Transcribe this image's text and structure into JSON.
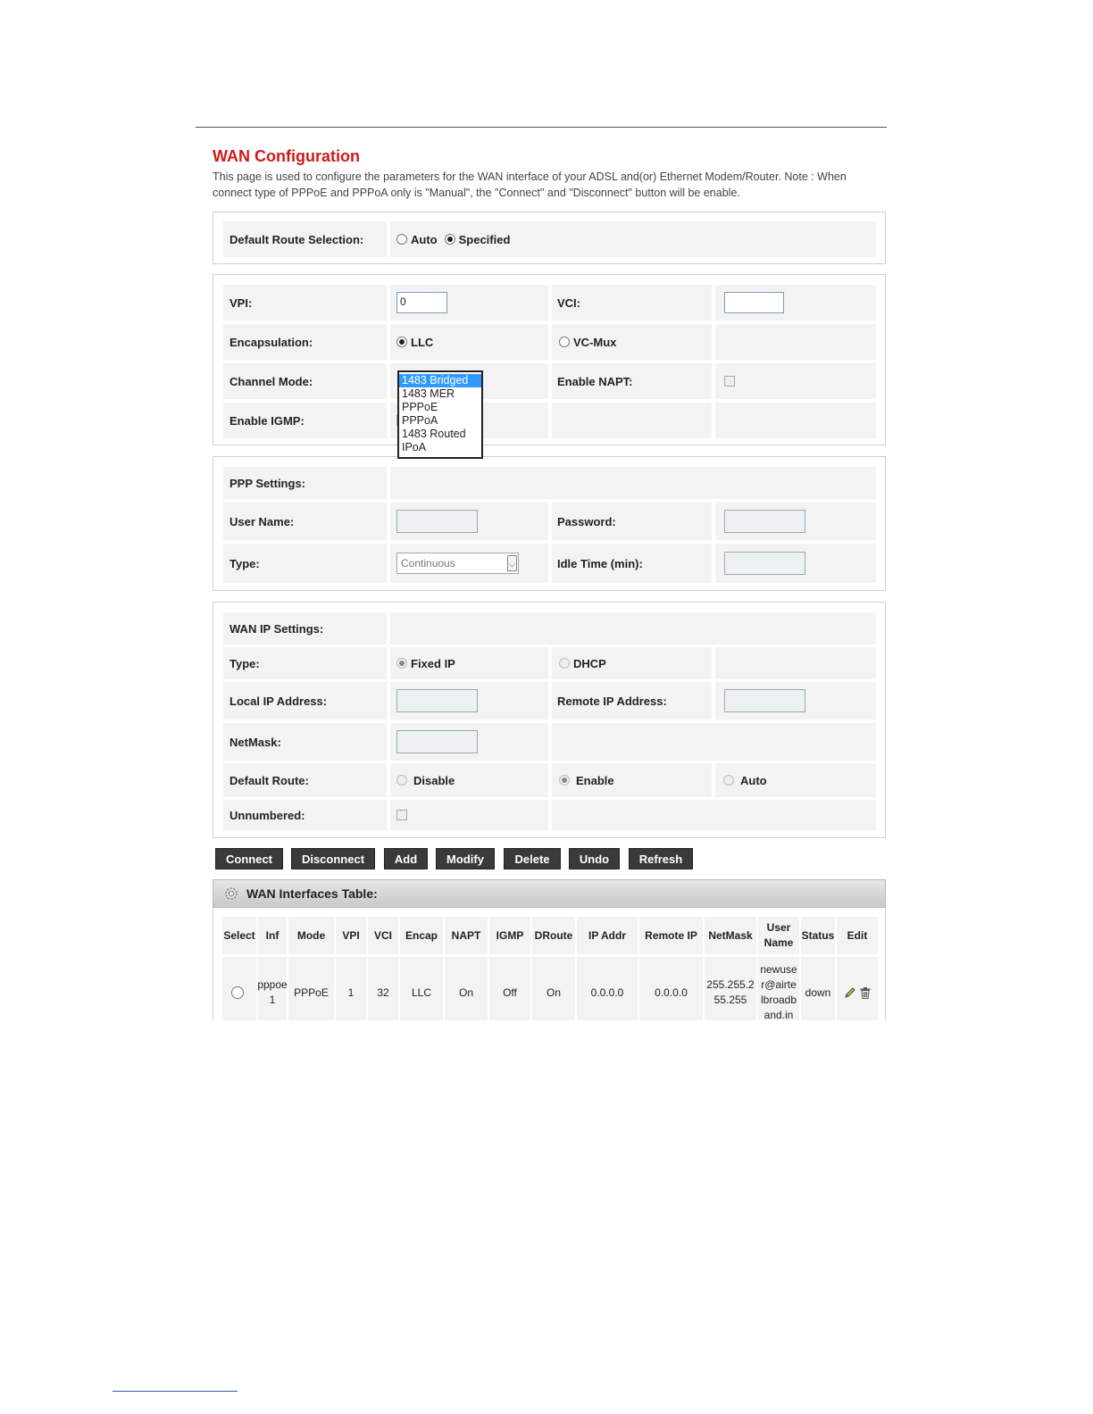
{
  "header": {
    "title": "WAN Configuration",
    "description": "This page is used to configure the parameters for the WAN interface of your ADSL and(or) Ethernet Modem/Router. Note : When connect type of PPPoE and PPPoA only is \"Manual\", the \"Connect\" and \"Disconnect\" button will be enable."
  },
  "default_route_selection": {
    "label": "Default Route Selection:",
    "opt_auto": "Auto",
    "opt_specified": "Specified"
  },
  "channel": {
    "vpi_label": "VPI:",
    "vpi_value": "0",
    "vci_label": "VCI:",
    "vci_value": "",
    "encap_label": "Encapsulation:",
    "encap_llc": "LLC",
    "encap_vcmux": "VC-Mux",
    "mode_label": "Channel Mode:",
    "napt_label": "Enable NAPT:",
    "igmp_label": "Enable IGMP:",
    "mode_options": [
      "1483 Bridged",
      "1483 MER",
      "PPPoE",
      "PPPoA",
      "1483 Routed",
      "IPoA"
    ]
  },
  "ppp": {
    "section_label": "PPP Settings:",
    "user_label": "User Name:",
    "password_label": "Password:",
    "type_label": "Type:",
    "type_value": "Continuous",
    "idle_label": "Idle Time (min):"
  },
  "wanip": {
    "section_label": "WAN IP Settings:",
    "type_label": "Type:",
    "type_fixed": "Fixed IP",
    "type_dhcp": "DHCP",
    "local_label": "Local IP Address:",
    "remote_label": "Remote IP Address:",
    "netmask_label": "NetMask:",
    "droute_label": "Default Route:",
    "droute_disable": "Disable",
    "droute_enable": "Enable",
    "droute_auto": "Auto",
    "unnumbered_label": "Unnumbered:"
  },
  "buttons": {
    "connect": "Connect",
    "disconnect": "Disconnect",
    "add": "Add",
    "modify": "Modify",
    "delete": "Delete",
    "undo": "Undo",
    "refresh": "Refresh"
  },
  "table": {
    "title": "WAN Interfaces Table:",
    "columns": [
      "Select",
      "Inf",
      "Mode",
      "VPI",
      "VCI",
      "Encap",
      "NAPT",
      "IGMP",
      "DRoute",
      "IP Addr",
      "Remote IP",
      "NetMask",
      "User Name",
      "Status",
      "Edit"
    ],
    "rows": [
      {
        "inf": "pppoe 1",
        "mode": "PPPoE",
        "vpi": "1",
        "vci": "32",
        "encap": "LLC",
        "napt": "On",
        "igmp": "Off",
        "droute": "On",
        "ipaddr": "0.0.0.0",
        "remoteip": "0.0.0.0",
        "netmask": "255.255.255.255",
        "username": "newuser@airtelbroadband.in",
        "status": "down"
      }
    ]
  },
  "icons": {
    "table_header": "gear-icon",
    "edit": "pencil-icon",
    "delete": "trash-icon"
  }
}
